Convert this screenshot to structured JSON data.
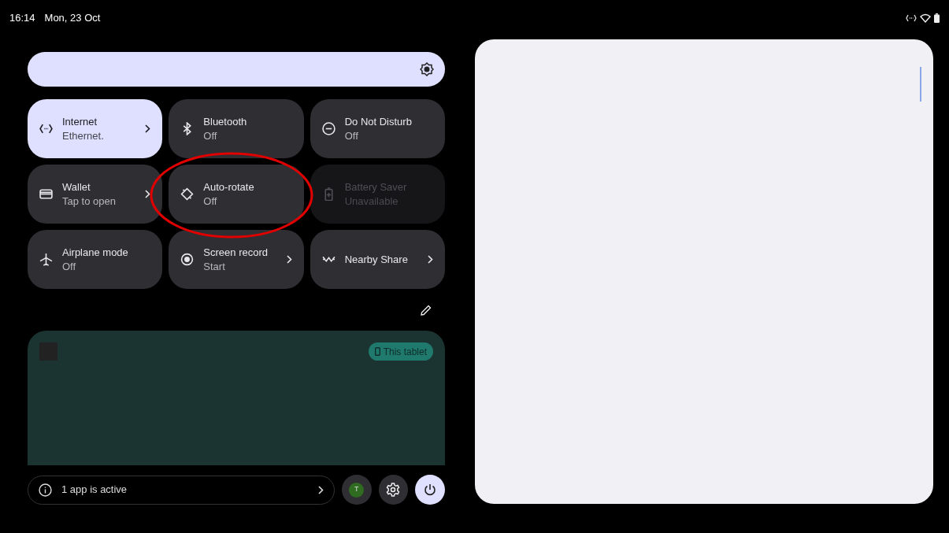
{
  "status_bar": {
    "time": "16:14",
    "date": "Mon, 23 Oct"
  },
  "brightness": {
    "level": 1
  },
  "tiles": [
    {
      "label": "Internet",
      "subtitle": "Ethernet.",
      "on": true,
      "disabled": false,
      "chevron": true
    },
    {
      "label": "Bluetooth",
      "subtitle": "Off",
      "on": false,
      "disabled": false,
      "chevron": false
    },
    {
      "label": "Do Not Disturb",
      "subtitle": "Off",
      "on": false,
      "disabled": false,
      "chevron": false
    },
    {
      "label": "Wallet",
      "subtitle": "Tap to open",
      "on": false,
      "disabled": false,
      "chevron": true
    },
    {
      "label": "Auto-rotate",
      "subtitle": "Off",
      "on": false,
      "disabled": false,
      "chevron": false
    },
    {
      "label": "Battery Saver",
      "subtitle": "Unavailable",
      "on": false,
      "disabled": true,
      "chevron": false
    },
    {
      "label": "Airplane mode",
      "subtitle": "Off",
      "on": false,
      "disabled": false,
      "chevron": false
    },
    {
      "label": "Screen record",
      "subtitle": "Start",
      "on": false,
      "disabled": false,
      "chevron": true
    },
    {
      "label": "Nearby Share",
      "on": false,
      "disabled": false,
      "chevron": true
    }
  ],
  "media": {
    "output_chip": "This tablet"
  },
  "footer": {
    "active_apps": "1 app is active",
    "user_initial": "T"
  }
}
